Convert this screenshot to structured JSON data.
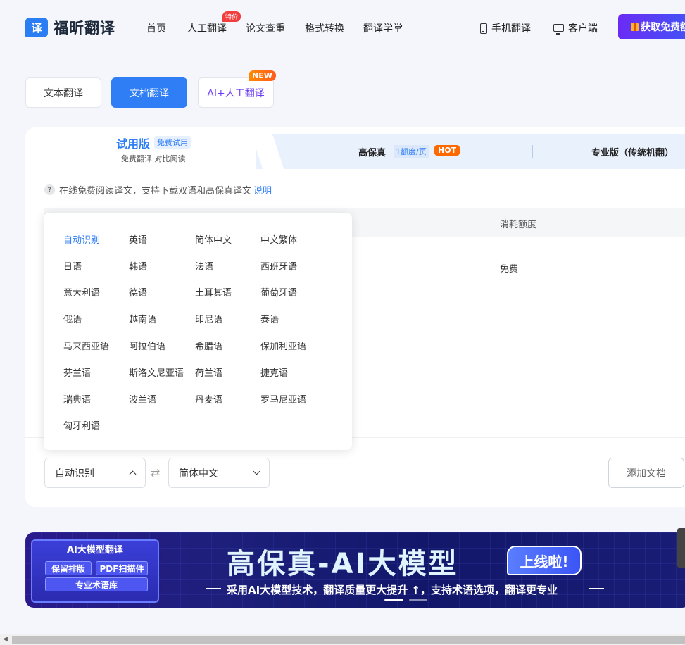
{
  "header": {
    "logo_mark": "译",
    "logo_text": "福昕翻译",
    "nav": [
      {
        "label": "首页"
      },
      {
        "label": "人工翻译",
        "badge": "特价"
      },
      {
        "label": "论文查重"
      },
      {
        "label": "格式转换"
      },
      {
        "label": "翻译学堂"
      }
    ],
    "mobile_label": "手机翻译",
    "client_label": "客户端",
    "cta_label": "获取免费额"
  },
  "modes": {
    "text": "文本翻译",
    "doc": "文档翻译",
    "ai": "AI+人工翻译",
    "ai_badge": "NEW"
  },
  "versions": {
    "trial_title": "试用版",
    "trial_tag": "免费试用",
    "trial_sub": "免费翻译 对比阅读",
    "hifi_label": "高保真",
    "hifi_quota": "1额度/页",
    "hifi_badge": "HOT",
    "pro_label": "专业版（传统机翻）"
  },
  "help": {
    "icon": "?",
    "text": "在线免费阅读译文，支持下载双语和高保真译文",
    "link": "说明"
  },
  "table": {
    "col_quota": "消耗额度",
    "cell_quota": "免费"
  },
  "languages": [
    "自动识别",
    "英语",
    "简体中文",
    "中文繁体",
    "日语",
    "韩语",
    "法语",
    "西班牙语",
    "意大利语",
    "德语",
    "土耳其语",
    "葡萄牙语",
    "俄语",
    "越南语",
    "印尼语",
    "泰语",
    "马来西亚语",
    "阿拉伯语",
    "希腊语",
    "保加利亚语",
    "芬兰语",
    "斯洛文尼亚语",
    "荷兰语",
    "捷克语",
    "瑞典语",
    "波兰语",
    "丹麦语",
    "罗马尼亚语",
    "匈牙利语"
  ],
  "selected_language": "自动识别",
  "selectors": {
    "source": "自动识别",
    "swap_icon": "⇄",
    "target": "简体中文",
    "add_doc": "添加文档"
  },
  "banner": {
    "chip_title": "AI大模型翻译",
    "chip_btn1": "保留排版",
    "chip_btn2": "PDF扫描件",
    "chip_btn3": "专业术语库",
    "title": "高保真-AI大模型",
    "bubble": "上线啦!",
    "subtitle": "采用AI大模型技术，翻译质量更大提升 ↑，支持术语选项，翻译更专业"
  }
}
